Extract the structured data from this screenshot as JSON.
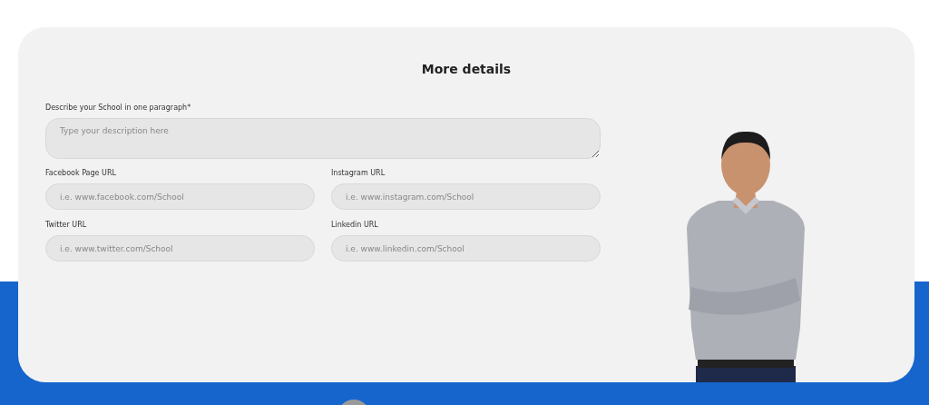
{
  "title": "More details",
  "description": {
    "label": "Describe your School in one paragraph*",
    "placeholder": "Type your description here"
  },
  "fields": [
    {
      "label": "Facebook Page URL",
      "placeholder": "i.e. www.facebook.com/School"
    },
    {
      "label": "Instagram URL",
      "placeholder": "i.e. www.instagram.com/School"
    },
    {
      "label": "Twitter URL",
      "placeholder": "i.e. www.twitter.com/School"
    },
    {
      "label": "Linkedin URL",
      "placeholder": "i.e. www.linkedin.com/School"
    }
  ]
}
